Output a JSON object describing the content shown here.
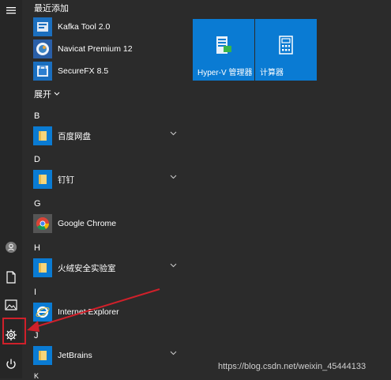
{
  "recent_header": "最近添加",
  "recent_apps": [
    {
      "label": "Kafka Tool 2.0",
      "icon": "kafka-icon"
    },
    {
      "label": "Navicat Premium 12",
      "icon": "navicat-icon"
    },
    {
      "label": "SecureFX 8.5",
      "icon": "securefx-icon"
    }
  ],
  "expand_label": "展开",
  "groups": [
    {
      "letter": "B",
      "app": "百度网盘",
      "icon": "folder-icon",
      "expandable": true
    },
    {
      "letter": "D",
      "app": "钉钉",
      "icon": "folder-icon",
      "expandable": true
    },
    {
      "letter": "G",
      "app": "Google Chrome",
      "icon": "chrome-icon",
      "expandable": false
    },
    {
      "letter": "H",
      "app": "火绒安全实验室",
      "icon": "folder-icon",
      "expandable": true
    },
    {
      "letter": "I",
      "app": "Internet Explorer",
      "icon": "ie-icon",
      "expandable": false
    },
    {
      "letter": "J",
      "app": "JetBrains",
      "icon": "folder-icon",
      "expandable": true
    }
  ],
  "tiles": [
    {
      "label": "Hyper-V 管理器",
      "icon": "hyperv-icon"
    },
    {
      "label": "计算器",
      "icon": "calculator-icon"
    }
  ],
  "rail_icons": [
    "hamburger-menu-icon",
    "user-icon",
    "document-icon",
    "pictures-icon",
    "settings-gear-icon",
    "power-icon"
  ],
  "colors": {
    "tile": "#0a7bd3",
    "highlight": "#d0202a",
    "background": "#2b2b2b"
  },
  "watermark": "https://blog.csdn.net/weixin_45444133"
}
